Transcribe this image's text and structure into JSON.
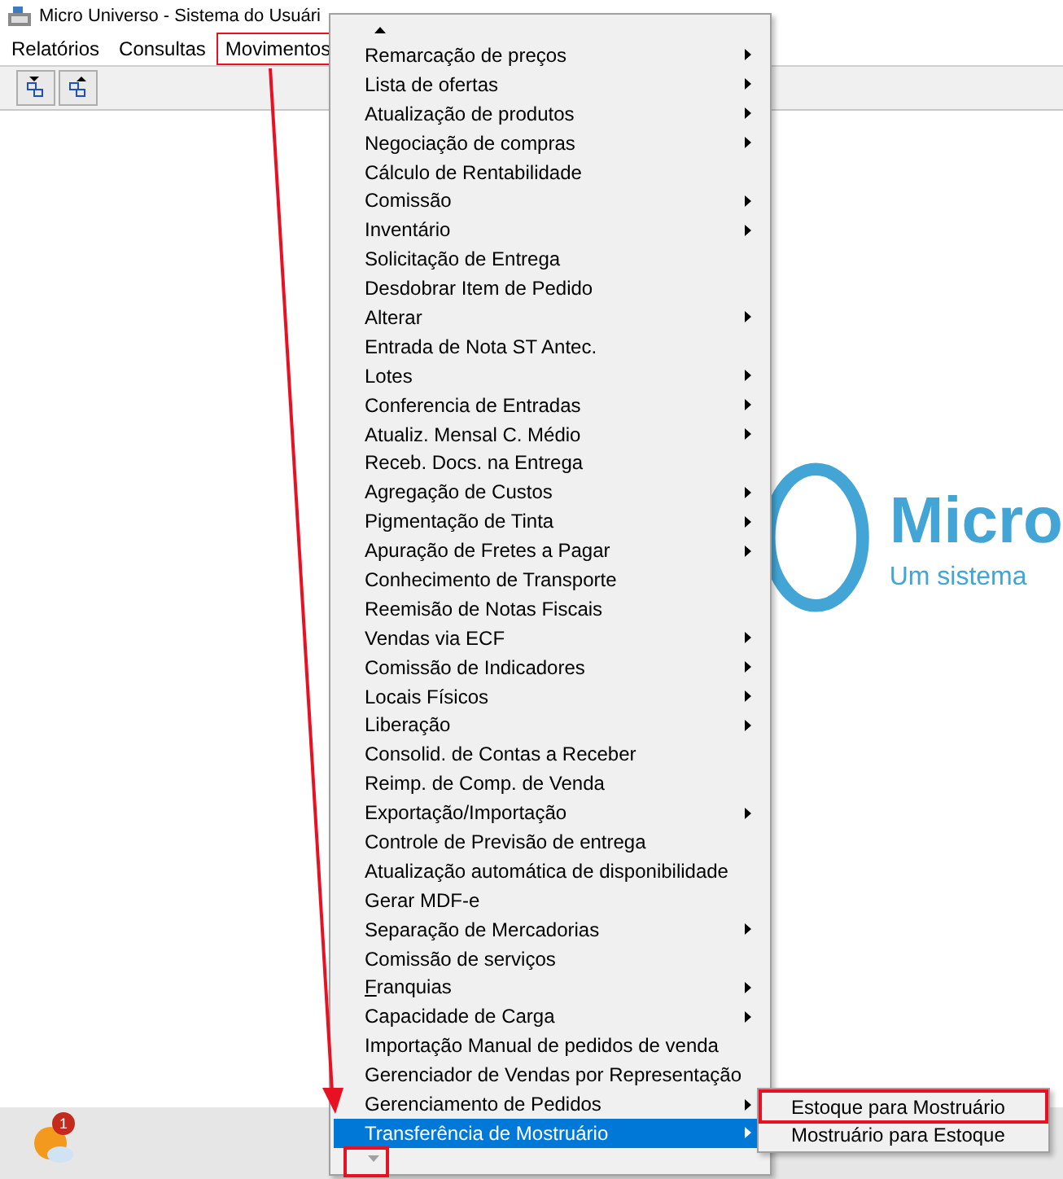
{
  "window": {
    "title": "Micro Universo - Sistema do Usuári"
  },
  "menubar": [
    {
      "label": "Relatórios",
      "selected": false
    },
    {
      "label": "Consultas",
      "selected": false
    },
    {
      "label": "Movimentos",
      "selected": true
    }
  ],
  "logo": {
    "name": "Micro",
    "tagline": "Um sistema"
  },
  "menu": {
    "items": [
      {
        "label": "Remarcação de preços",
        "submenu": true,
        "selected": false
      },
      {
        "label": "Lista de ofertas",
        "submenu": true,
        "selected": false
      },
      {
        "label": "Atualização de produtos",
        "submenu": true,
        "selected": false
      },
      {
        "label": "Negociação de compras",
        "submenu": true,
        "selected": false
      },
      {
        "label": "Cálculo de Rentabilidade",
        "submenu": false,
        "selected": false
      },
      {
        "label": "Comissão",
        "submenu": true,
        "selected": false
      },
      {
        "label": "Inventário",
        "submenu": true,
        "selected": false
      },
      {
        "label": "Solicitação de Entrega",
        "submenu": false,
        "selected": false
      },
      {
        "label": "Desdobrar Item de Pedido",
        "submenu": false,
        "selected": false
      },
      {
        "label": "Alterar",
        "submenu": true,
        "selected": false
      },
      {
        "label": "Entrada de Nota ST Antec.",
        "submenu": false,
        "selected": false
      },
      {
        "label": "Lotes",
        "submenu": true,
        "selected": false
      },
      {
        "label": "Conferencia de Entradas",
        "submenu": true,
        "selected": false
      },
      {
        "label": "Atualiz. Mensal C. Médio",
        "submenu": true,
        "selected": false
      },
      {
        "label": "Receb. Docs. na Entrega",
        "submenu": false,
        "selected": false
      },
      {
        "label": "Agregação de Custos",
        "submenu": true,
        "selected": false
      },
      {
        "label": "Pigmentação de Tinta",
        "submenu": true,
        "selected": false
      },
      {
        "label": "Apuração de Fretes a Pagar",
        "submenu": true,
        "selected": false
      },
      {
        "label": "Conhecimento de Transporte",
        "submenu": false,
        "selected": false
      },
      {
        "label": "Reemisão de Notas Fiscais",
        "submenu": false,
        "selected": false
      },
      {
        "label": "Vendas via ECF",
        "submenu": true,
        "selected": false
      },
      {
        "label": "Comissão de Indicadores",
        "submenu": true,
        "selected": false
      },
      {
        "label": "Locais Físicos",
        "submenu": true,
        "selected": false
      },
      {
        "label": "Liberação",
        "submenu": true,
        "selected": false
      },
      {
        "label": "Consolid. de Contas a Receber",
        "submenu": false,
        "selected": false
      },
      {
        "label": "Reimp. de Comp. de Venda",
        "submenu": false,
        "selected": false
      },
      {
        "label": "Exportação/Importação",
        "submenu": true,
        "selected": false
      },
      {
        "label": "Controle de Previsão de entrega",
        "submenu": false,
        "selected": false
      },
      {
        "label": "Atualização automática de disponibilidade",
        "submenu": false,
        "selected": false
      },
      {
        "label": "Gerar MDF-e",
        "submenu": false,
        "selected": false
      },
      {
        "label": "Separação de Mercadorias",
        "submenu": true,
        "selected": false
      },
      {
        "label": "Comissão de serviços",
        "submenu": false,
        "selected": false
      },
      {
        "label": "Franquias",
        "submenu": true,
        "selected": false,
        "underlined_first": true
      },
      {
        "label": "Capacidade de Carga",
        "submenu": true,
        "selected": false
      },
      {
        "label": "Importação Manual de pedidos de venda",
        "submenu": false,
        "selected": false
      },
      {
        "label": "Gerenciador de Vendas por Representação",
        "submenu": false,
        "selected": false
      },
      {
        "label": "Gerenciamento de Pedidos",
        "submenu": true,
        "selected": false
      },
      {
        "label": "Transferência de Mostruário",
        "submenu": true,
        "selected": true
      }
    ]
  },
  "submenu": {
    "items": [
      {
        "label": "Estoque para Mostruário",
        "highlighted": true
      },
      {
        "label": "Mostruário para Estoque",
        "highlighted": false
      }
    ]
  },
  "taskbar": {
    "badge": "1"
  }
}
